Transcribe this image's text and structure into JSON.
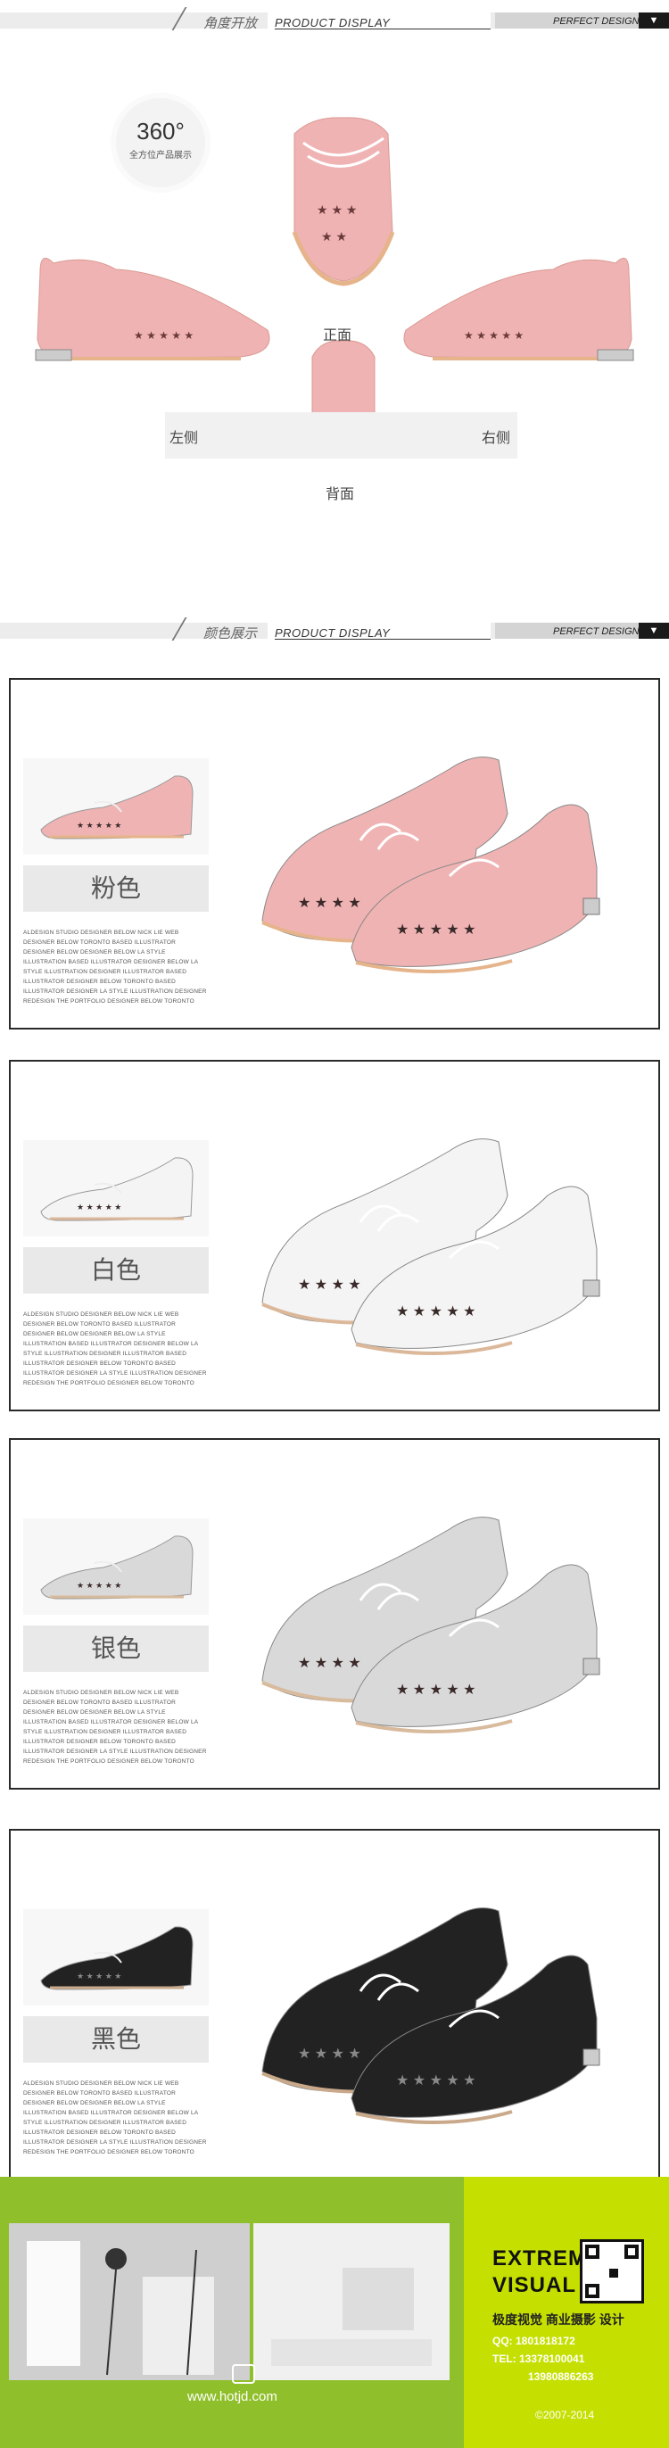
{
  "section1": {
    "cn": "角度开放",
    "en": "PRODUCT DISPLAY",
    "pd": "PERFECT DESIGN"
  },
  "badge": {
    "big": "360°",
    "small": "全方位产品展示"
  },
  "views": {
    "front": "正面",
    "left": "左侧",
    "right": "右侧",
    "back": "背面"
  },
  "section2": {
    "cn": "颜色展示",
    "en": "PRODUCT DISPLAY",
    "pd": "PERFECT DESIGN"
  },
  "cards": [
    {
      "color_label": "粉色",
      "shoe_color": "#f0b3b3",
      "sole": "#e6b48b"
    },
    {
      "color_label": "白色",
      "shoe_color": "#f4f4f4",
      "sole": "#dcb89a"
    },
    {
      "color_label": "银色",
      "shoe_color": "#d9d9d9",
      "sole": "#d8ba9c"
    },
    {
      "color_label": "黑色",
      "shoe_color": "#222222",
      "sole": "#c9a98a"
    }
  ],
  "card_desc": "ALDESIGN STUDIO DESIGNER BELOW NICK LIE WEB DESIGNER BELOW TORONTO BASED ILLUSTRATOR DESIGNER BELOW DESIGNER BELOW LA STYLE ILLUSTRATION BASED ILLUSTRATOR DESIGNER BELOW LA STYLE ILLUSTRATION DESIGNER ILLUSTRATOR BASED ILLUSTRATOR DESIGNER BELOW TORONTO BASED ILLUSTRATOR DESIGNER LA STYLE ILLUSTRATION DESIGNER REDESIGN THE PORTFOLIO DESIGNER BELOW TORONTO",
  "footer": {
    "url": "www.hotjd.com",
    "brand1": "EXTREME",
    "brand2": "VISUAL",
    "tagline": "极度视觉 商业摄影 设计",
    "qq": "QQ:  1801818172",
    "tel1": "TEL:  13378100041",
    "tel2": "13980886263",
    "copy": "©2007-2014"
  },
  "colors": {
    "header_gray": "#ececec",
    "footer_green": "#8fbf2a",
    "footer_panel": "#c5e000"
  }
}
